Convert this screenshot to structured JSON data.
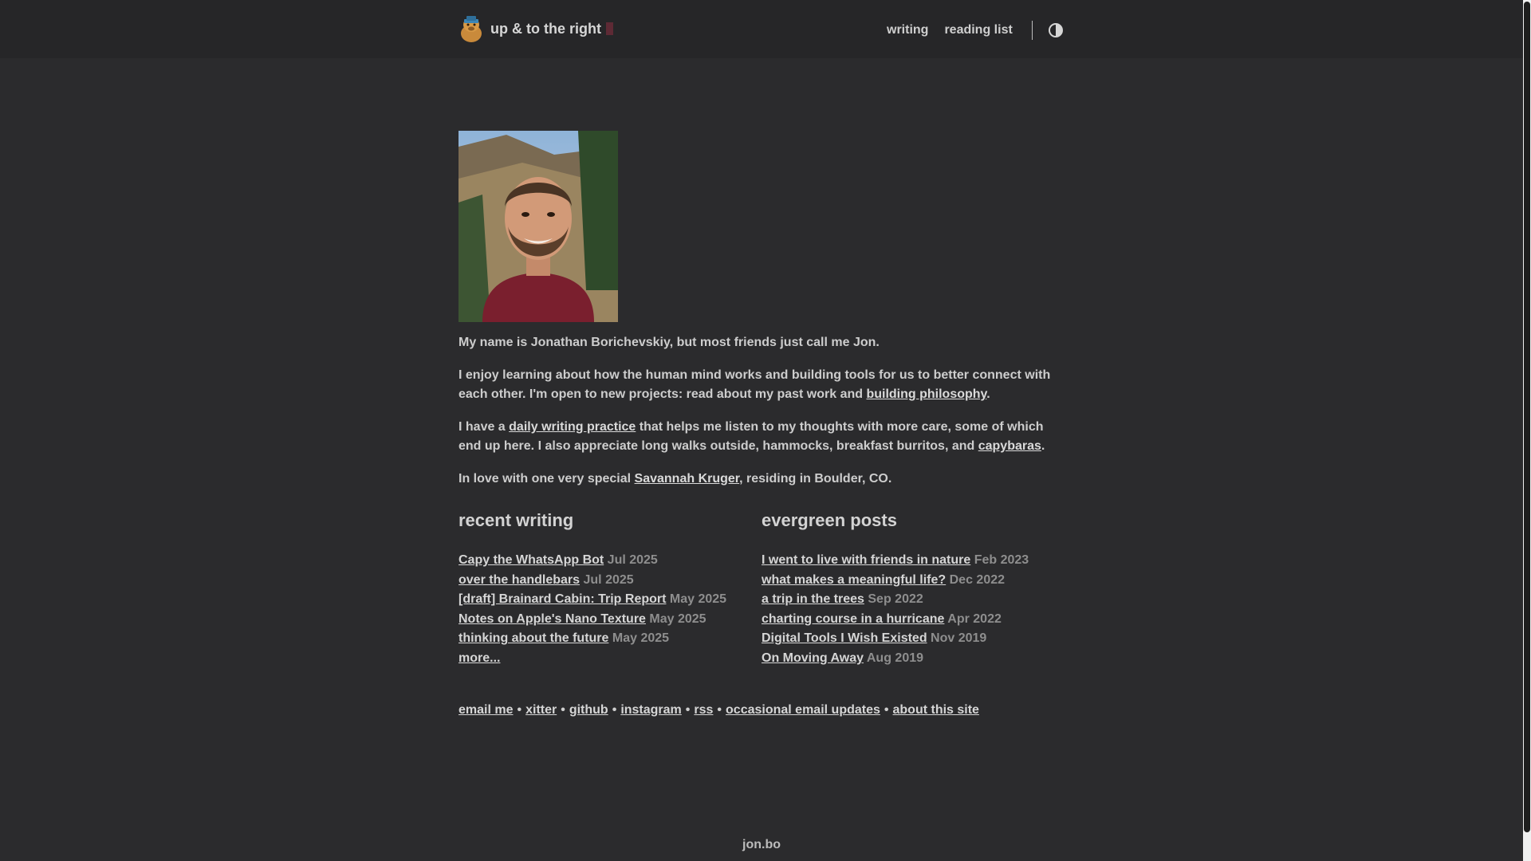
{
  "header": {
    "site_title": "up & to the right",
    "nav": [
      {
        "label": "writing"
      },
      {
        "label": "reading list"
      }
    ],
    "theme_toggle_icon": "contrast-icon",
    "logo_icon": "capybara-icon"
  },
  "intro": {
    "p1": "My name is Jonathan Borichevskiy, but most friends just call me Jon.",
    "p2_a": "I enjoy learning about how the human mind works and building tools for us to better connect with each other. I'm open to new projects: read about my past work and ",
    "p2_link": "building philosophy",
    "p2_b": ".",
    "p3_a": "I have a ",
    "p3_link1": "daily writing practice",
    "p3_b": " that helps me listen to my thoughts with more care, some of which end up here. I also appreciate long walks outside, hammocks, breakfast burritos, and ",
    "p3_link2": "capybaras",
    "p3_c": ".",
    "p4_a": "In love with one very special ",
    "p4_link": "Savannah Kruger",
    "p4_b": ", residing in Boulder, CO."
  },
  "recent": {
    "heading": "recent writing",
    "posts": [
      {
        "title": "Capy the WhatsApp Bot",
        "date": "Jul 2025"
      },
      {
        "title": "over the handlebars",
        "date": "Jul 2025"
      },
      {
        "title": "[draft] Brainard Cabin: Trip Report",
        "date": "May 2025"
      },
      {
        "title": "Notes on Apple's Nano Texture",
        "date": "May 2025"
      },
      {
        "title": "thinking about the future",
        "date": "May 2025"
      }
    ],
    "more": "more..."
  },
  "evergreen": {
    "heading": "evergreen posts",
    "posts": [
      {
        "title": "I went to live with friends in nature",
        "date": "Feb 2023"
      },
      {
        "title": "what makes a meaningful life?",
        "date": "Dec 2022"
      },
      {
        "title": "a trip in the trees",
        "date": "Sep 2022"
      },
      {
        "title": "charting course in a hurricane",
        "date": "Apr 2022"
      },
      {
        "title": "Digital Tools I Wish Existed",
        "date": "Nov 2019"
      },
      {
        "title": "On Moving Away",
        "date": "Aug 2019"
      }
    ]
  },
  "links": {
    "items": [
      "email me",
      "xitter",
      "github",
      "instagram",
      "rss",
      "occasional email updates",
      "about this site"
    ],
    "separator": "•"
  },
  "footer": {
    "domain": "jon.bo"
  },
  "colors": {
    "background": "#2b2b2d",
    "topbar": "#262628",
    "text": "#cdcdcd",
    "date": "#8e8e8e",
    "cursor_accent": "#5e2a35"
  }
}
